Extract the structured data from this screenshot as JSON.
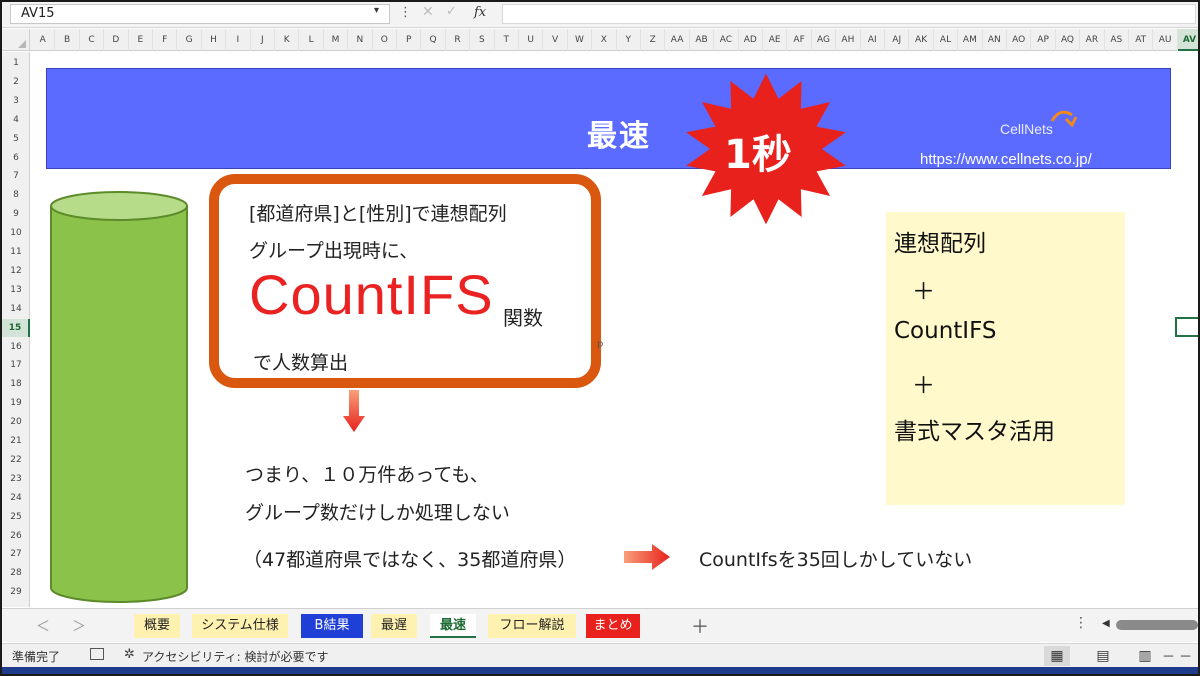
{
  "formula_bar": {
    "name_box": "AV15",
    "fx_label": "fx",
    "dots": "⋮",
    "cancel_glyph": "✕",
    "confirm_glyph": "✓",
    "dropdown_glyph": "▾"
  },
  "columns": [
    "A",
    "B",
    "C",
    "D",
    "E",
    "F",
    "G",
    "H",
    "I",
    "J",
    "K",
    "L",
    "M",
    "N",
    "O",
    "P",
    "Q",
    "R",
    "S",
    "T",
    "U",
    "V",
    "W",
    "X",
    "Y",
    "Z",
    "AA",
    "AB",
    "AC",
    "AD",
    "AE",
    "AF",
    "AG",
    "AH",
    "AI",
    "AJ",
    "AK",
    "AL",
    "AM",
    "AN",
    "AO",
    "AP",
    "AQ",
    "AR",
    "AS",
    "AT",
    "AU",
    "AV"
  ],
  "selected_column": "AV",
  "rows": [
    "1",
    "2",
    "3",
    "4",
    "5",
    "6",
    "7",
    "8",
    "9",
    "10",
    "11",
    "12",
    "13",
    "14",
    "15",
    "16",
    "17",
    "18",
    "19",
    "20",
    "21",
    "22",
    "23",
    "24",
    "25",
    "26",
    "27",
    "28",
    "29"
  ],
  "selected_row": "15",
  "banner": {
    "title": "最速",
    "logo_text": "CellNets",
    "url": "https://www.cellnets.co.jp/",
    "bg_color": "#5b6bff"
  },
  "burst": {
    "label": "1秒",
    "color": "#e8211c"
  },
  "callout": {
    "line1": "[都道府県]と[性別]で連想配列",
    "line2": "グループ出現時に、",
    "big": "CountIFS",
    "suffix": "関数",
    "line4": "で人数算出",
    "border_color": "#d9570f",
    "big_color": "#ea2222"
  },
  "stray_mark": "ᵖ",
  "body": {
    "line1": "つまり、１０万件あっても、",
    "line2": "グループ数だけしか処理しない",
    "line3": "（47都道府県ではなく、35都道府県）",
    "line4": "CountIfsを35回しかしていない"
  },
  "note": {
    "lines": [
      "連想配列",
      "＋",
      "CountIFS",
      "＋",
      "書式マスタ活用"
    ],
    "bg_color": "#fff9cc"
  },
  "tabs": {
    "prev": "＜",
    "next": "＞",
    "add": "＋",
    "more": "⋮",
    "scroll_left": "◀",
    "items": [
      {
        "label": "概要",
        "bg": "#fff2b0",
        "color": "#222"
      },
      {
        "label": "システム仕様",
        "bg": "#fff2b0",
        "color": "#222"
      },
      {
        "label": "B結果",
        "bg": "#1f3fd6",
        "color": "#ffffff"
      },
      {
        "label": "最遅",
        "bg": "#fff2b0",
        "color": "#222"
      },
      {
        "label": "最速",
        "bg": "#ffffff",
        "color": "#1e6b35"
      },
      {
        "label": "フロー解説",
        "bg": "#fff2b0",
        "color": "#222"
      },
      {
        "label": "まとめ",
        "bg": "#e8211c",
        "color": "#ffffff"
      }
    ],
    "active": "最速"
  },
  "status": {
    "ready": "準備完了",
    "accessibility": "アクセシビリティ: 検討が必要です",
    "zoom_minus": "－ －"
  }
}
